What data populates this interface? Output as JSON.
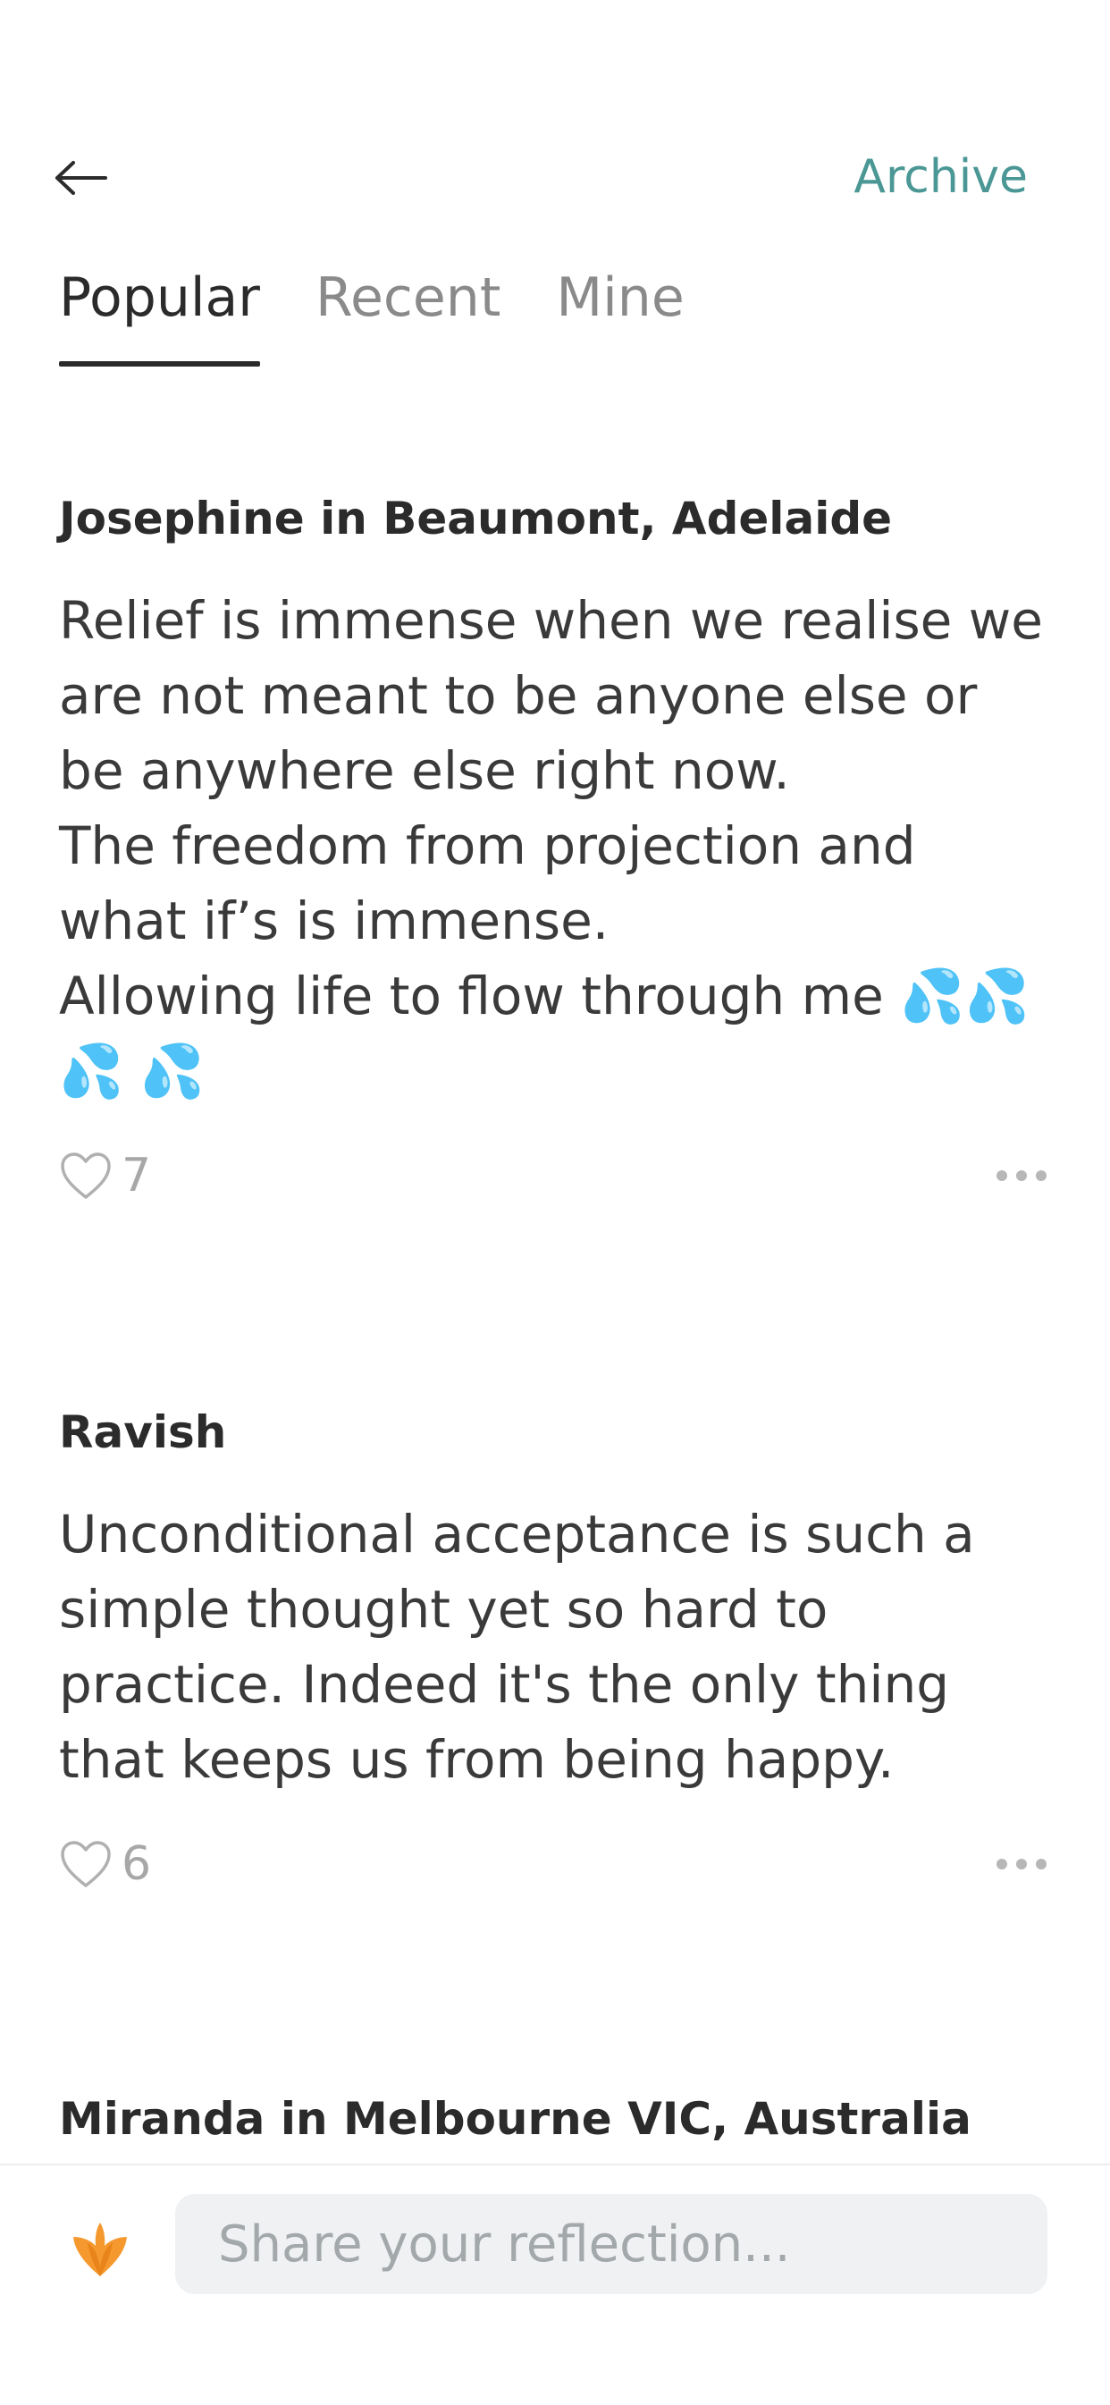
{
  "header": {
    "back_icon": "arrow-left-icon",
    "archive_label": "Archive",
    "accent_color": "#4a9795"
  },
  "tabs": [
    {
      "label": "Popular",
      "active": true
    },
    {
      "label": "Recent",
      "active": false
    },
    {
      "label": "Mine",
      "active": false
    }
  ],
  "posts": [
    {
      "author": "Josephine in Beaumont, Adelaide",
      "body": "Relief is immense when we realise we are not meant to be anyone else or be anywhere else right now.\nThe freedom from projection and what if’s is immense.\nAllowing life to flow through me 💦💦💦 💦",
      "likes": "7"
    },
    {
      "author": "Ravish",
      "body": "Unconditional acceptance is such a simple thought yet so hard to practice. Indeed it's the only thing that keeps us from being happy.",
      "likes": "6"
    },
    {
      "author": "Miranda in Melbourne VIC, Australia",
      "body": "",
      "likes": ""
    }
  ],
  "compose": {
    "placeholder": "Share your reflection...",
    "logo_icon": "lotus-logo-icon",
    "logo_color": "#f5992f"
  }
}
